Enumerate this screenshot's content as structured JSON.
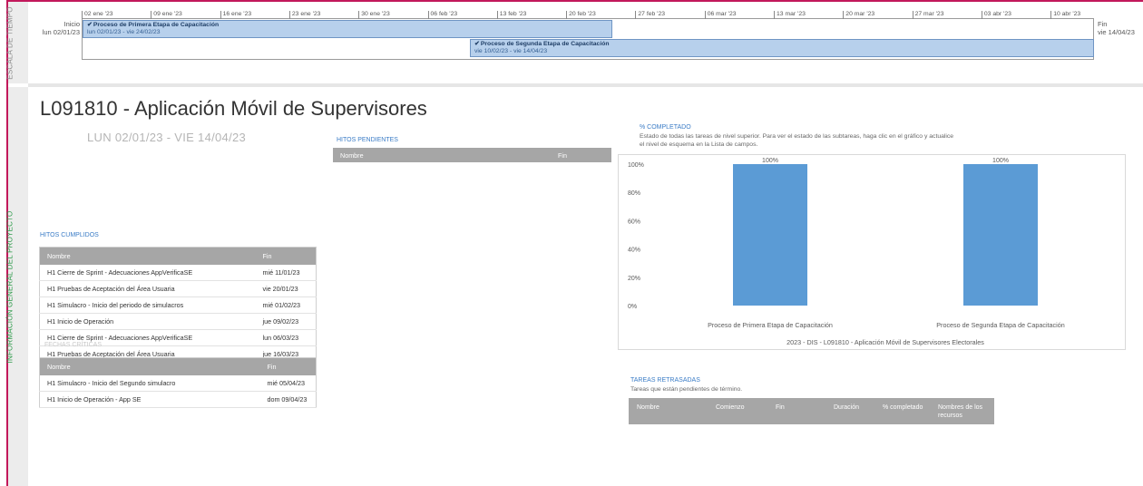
{
  "side": {
    "timeline_label": "ESCALA DE TIEMPO",
    "project_label": "INFORMACIÓN GENERAL DEL PROYECTO"
  },
  "timeline": {
    "start_label": "Inicio",
    "start_date": "lun 02/01/23",
    "end_label": "Fin",
    "end_date": "vie 14/04/23",
    "dates": [
      "02 ene '23",
      "09 ene '23",
      "16 ene '23",
      "23 ene '23",
      "30 ene '23",
      "06 feb '23",
      "13 feb '23",
      "20 feb '23",
      "27 feb '23",
      "06 mar '23",
      "13 mar '23",
      "20 mar '23",
      "27 mar '23",
      "03 abr '23",
      "10 abr '23"
    ],
    "bars": [
      {
        "name": "Proceso de Primera Etapa de Capacitación",
        "range": "lun 02/01/23 - vie 24/02/23"
      },
      {
        "name": "Proceso de Segunda Etapa de Capacitación",
        "range": "vie 10/02/23 - vie 14/04/23"
      }
    ]
  },
  "project": {
    "title": "L091810 - Aplicación Móvil de Supervisores",
    "dates": "LUN 02/01/23 - VIE 14/04/23"
  },
  "hitos_pendientes": {
    "label": "HITOS PENDIENTES",
    "columns": [
      "Nombre",
      "Fin"
    ]
  },
  "hitos_cumplidos": {
    "label": "HITOS CUMPLIDOS",
    "columns": [
      "Nombre",
      "Fin"
    ],
    "rows": [
      [
        "H1 Cierre de Sprint - Adecuaciones AppVerificaSE",
        "mié 11/01/23"
      ],
      [
        "H1 Pruebas de Aceptación del Área Usuaria",
        "vie 20/01/23"
      ],
      [
        "H1 Simulacro - Inicio del periodo de simulacros",
        "mié 01/02/23"
      ],
      [
        "H1 Inicio de Operación",
        "jue 09/02/23"
      ],
      [
        "H1 Cierre de Sprint - Adecuaciones AppVerificaSE",
        "lun 06/03/23"
      ],
      [
        "H1 Pruebas de Aceptación del Área Usuaria",
        "jue 16/03/23"
      ]
    ]
  },
  "fechas_criticas": {
    "label": "FECHAS CRÍTICAS",
    "columns": [
      "Nombre",
      "Fin"
    ],
    "rows": [
      [
        "H1 Simulacro - Inicio del Segundo simulacro",
        "mié 05/04/23"
      ],
      [
        "H1 Inicio de Operación - App SE",
        "dom 09/04/23"
      ]
    ]
  },
  "completado": {
    "label": "% COMPLETADO",
    "description": "Estado de todas las tareas de nivel superior. Para ver el estado de las subtareas, haga clic en el gráfico y actualice el nivel de esquema en la Lista de campos."
  },
  "chart_data": {
    "type": "bar",
    "categories": [
      "Proceso de Primera Etapa de Capacitación",
      "Proceso de Segunda Etapa de Capacitación"
    ],
    "values": [
      1.0,
      1.0
    ],
    "data_labels": [
      "100%",
      "100%"
    ],
    "y_ticks": [
      "0%",
      "20%",
      "40%",
      "60%",
      "80%",
      "100%"
    ],
    "ylim": [
      0,
      1
    ],
    "xlabel": "2023 - DIS - L091810 - Aplicación Móvil de Supervisores Electorales",
    "ylabel": "",
    "bar_color": "#5b9bd5",
    "grid": false
  },
  "tareas_retrasadas": {
    "label": "TAREAS RETRASADAS",
    "description": "Tareas que están pendientes de término.",
    "columns": [
      "Nombre",
      "Comienzo",
      "Fin",
      "Duración",
      "% completado",
      "Nombres de los recursos"
    ]
  }
}
